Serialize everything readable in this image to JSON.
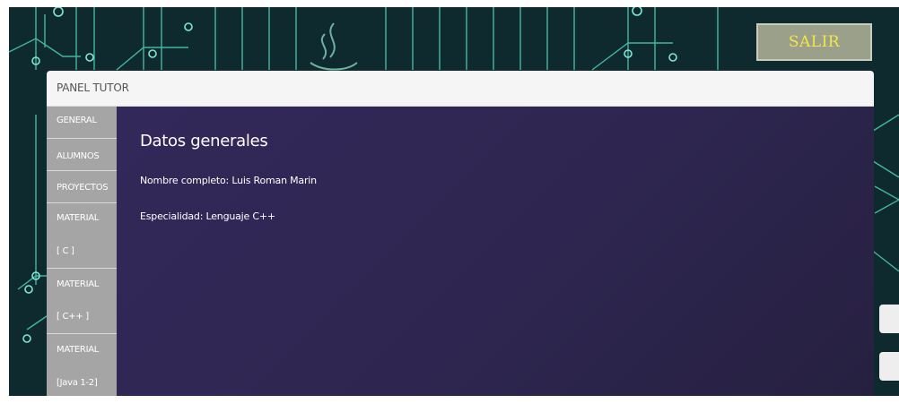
{
  "header": {
    "logout_label": "SALIR"
  },
  "panel": {
    "title": "PANEL TUTOR"
  },
  "menu": {
    "items": [
      {
        "line1": "GENERAL",
        "line2": ""
      },
      {
        "line1": "ALUMNOS",
        "line2": ""
      },
      {
        "line1": "PROYECTOS",
        "line2": ""
      },
      {
        "line1": "MATERIAL",
        "line2": "[ C ]"
      },
      {
        "line1": "MATERIAL",
        "line2": "[ C++ ]"
      },
      {
        "line1": "MATERIAL",
        "line2": "[Java 1-2]"
      }
    ]
  },
  "content": {
    "title": "Datos generales",
    "full_name_line": "Nombre completo: Luis Roman Marin",
    "specialty_line": "Especialidad: Lenguaje C++"
  },
  "colors": {
    "background_dark": "#0f2a2e",
    "circuit_lines": "#4fd9c0",
    "logout_button_bg": "#9aa08a",
    "logout_button_text": "#f4e64a",
    "menu_item_bg": "#a5a5a5",
    "content_bg": "#2e2650"
  }
}
